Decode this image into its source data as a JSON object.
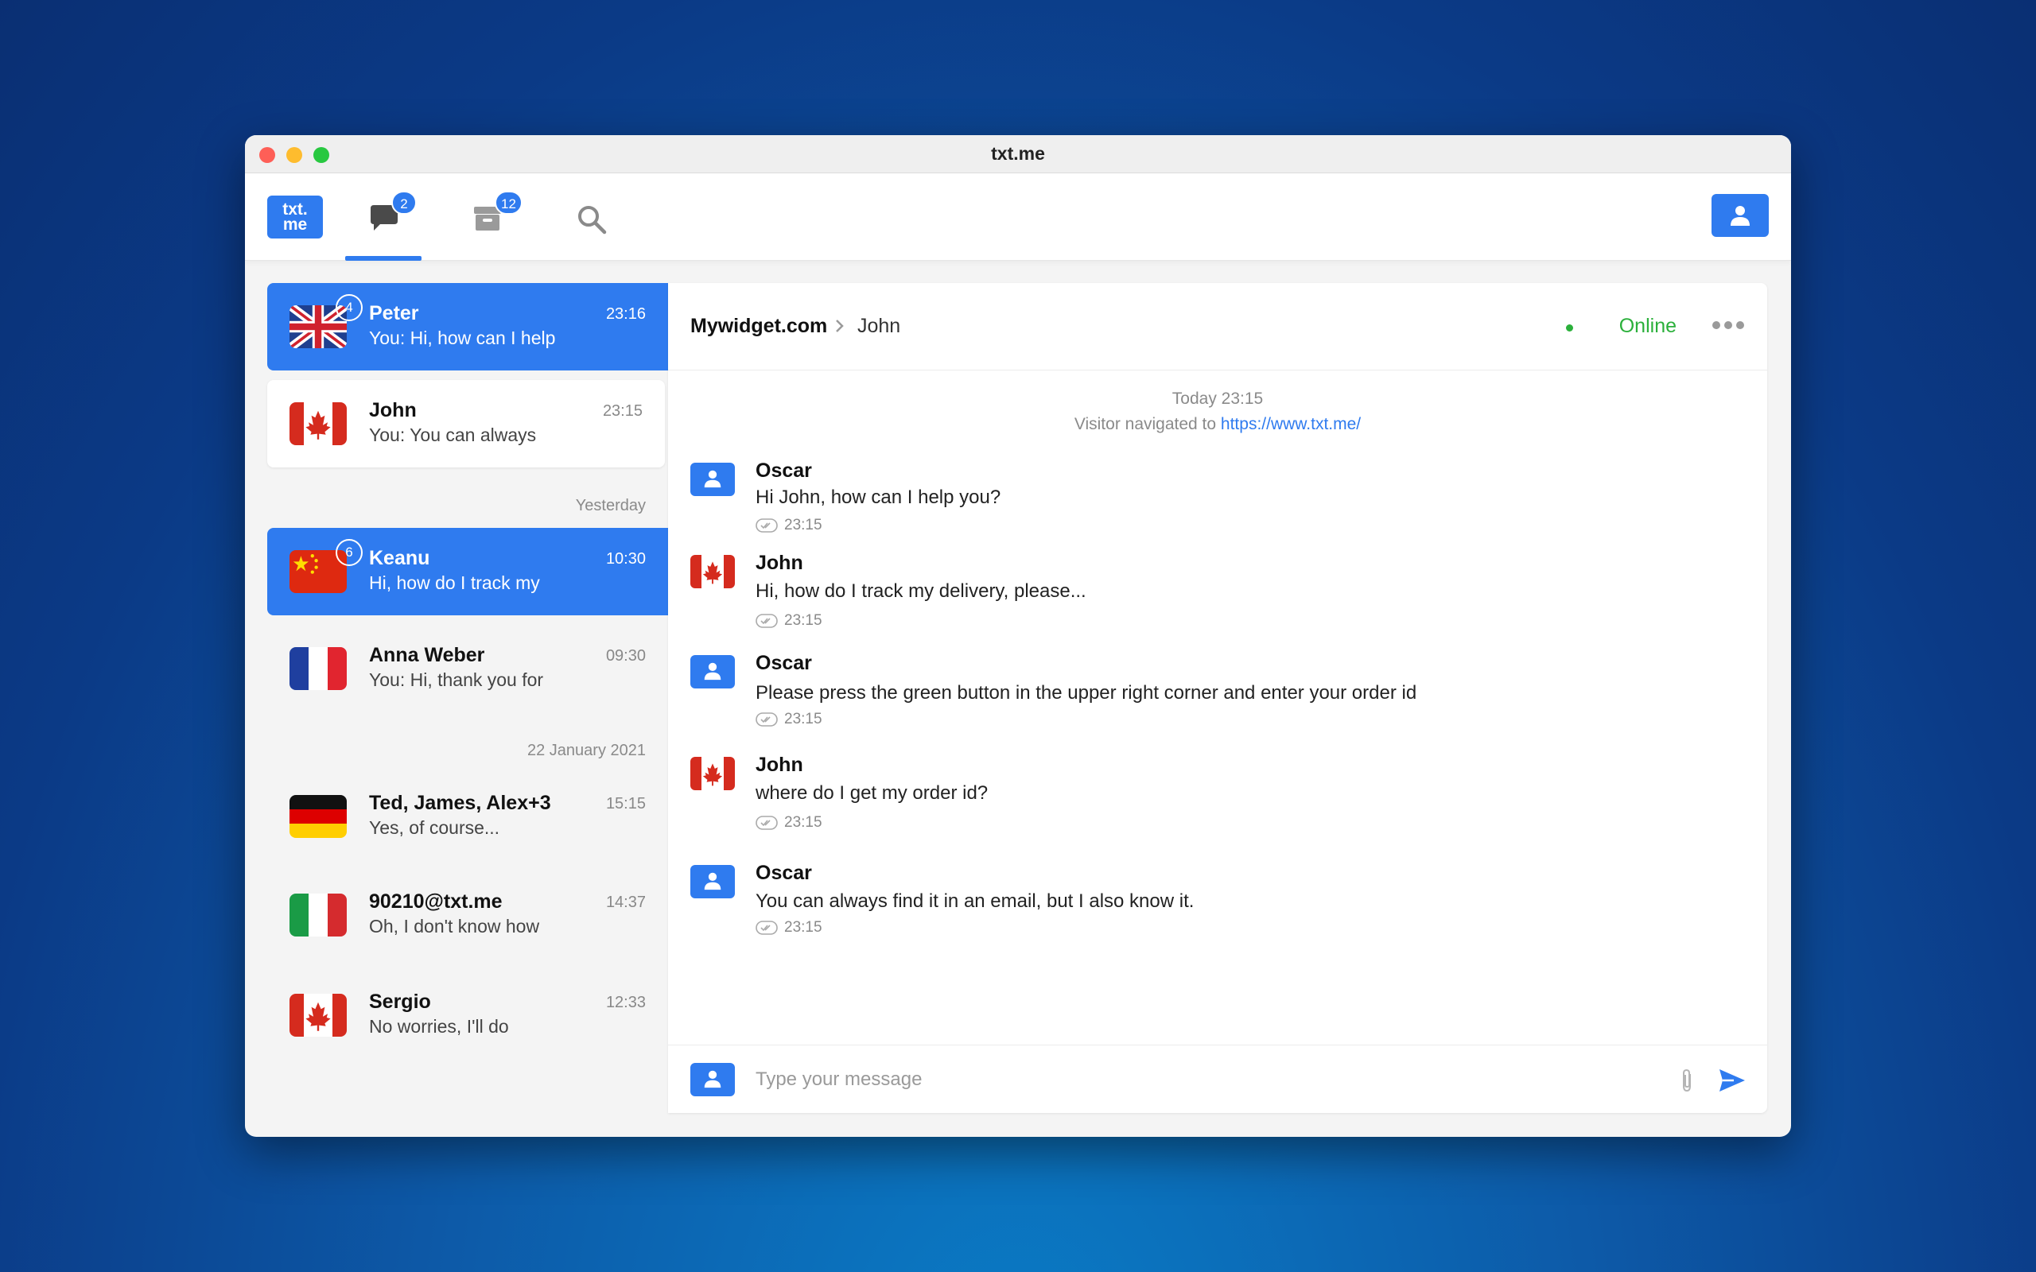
{
  "window": {
    "title": "txt.me"
  },
  "toolbar": {
    "logo_top": "txt.",
    "logo_bottom": "me",
    "chats_badge": "2",
    "archive_badge": "12"
  },
  "conversations": [
    {
      "name": "Peter",
      "time": "23:16",
      "preview": "You: Hi, how can I help",
      "unread": "4",
      "flag": "uk-flag-icon"
    },
    {
      "name": "John",
      "time": "23:15",
      "preview": "You: You can always",
      "flag": "canada-flag-icon"
    },
    {
      "name": "Keanu",
      "time": "10:30",
      "preview": "Hi, how do I track my",
      "unread": "6",
      "flag": "china-flag-icon"
    },
    {
      "name": "Anna Weber",
      "time": "09:30",
      "preview": "You: Hi, thank you for",
      "flag": "france-flag-icon"
    },
    {
      "name": "Ted, James, Alex+3",
      "time": "15:15",
      "preview": "Yes, of course...",
      "flag": "germany-flag-icon"
    },
    {
      "name": "90210@txt.me",
      "time": "14:37",
      "preview": "Oh, I don't know how",
      "flag": "italy-flag-icon"
    },
    {
      "name": "Sergio",
      "time": "12:33",
      "preview": "No worries, I'll do",
      "flag": "canada-flag-icon"
    }
  ],
  "date_separators": [
    "Yesterday",
    "22 January 2021"
  ],
  "chat": {
    "site": "Mywidget.com",
    "contact": "John",
    "status": "Online",
    "system_time": "Today  23:15",
    "system_text": "Visitor navigated to",
    "system_link": "https://www.txt.me/",
    "messages": [
      {
        "author": "Oscar",
        "text": "Hi John, how can I help you?",
        "time": "23:15"
      },
      {
        "author": "John",
        "text": "Hi, how do I track my delivery, please...",
        "time": "23:15"
      },
      {
        "author": "Oscar",
        "text": "Please press the green button in the upper right corner and enter your order id",
        "time": "23:15"
      },
      {
        "author": "John",
        "text": "where do I get my order id?",
        "time": "23:15"
      },
      {
        "author": "Oscar",
        "text": "You can always find it in an email, but I also know it.",
        "time": "23:15"
      }
    ],
    "composer_placeholder": "Type your message"
  },
  "colors": {
    "accent": "#2f7bef",
    "online": "#2bb03b"
  }
}
